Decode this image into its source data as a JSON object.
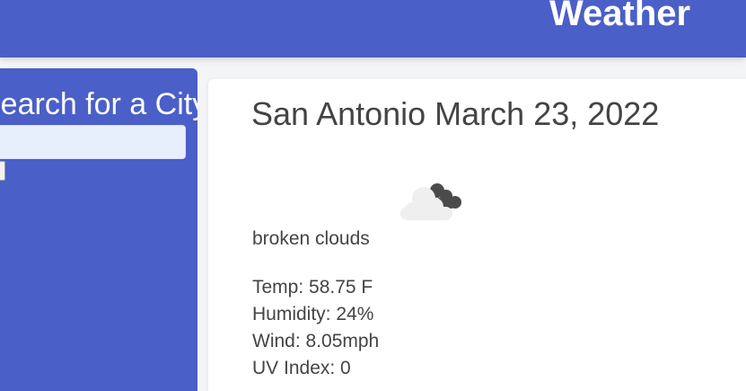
{
  "header": {
    "title": "Weather",
    "color": "#4a5fc8"
  },
  "sidebar": {
    "heading": "Search for a City:",
    "input_value": "",
    "search_button_label": "",
    "color": "#4a5fc8"
  },
  "current": {
    "city_date": "San Antonio March 23, 2022",
    "icon": "broken-clouds-icon",
    "description": "broken clouds",
    "temp": "Temp: 58.75 F",
    "humidity": "Humidity: 24%",
    "wind": "Wind: 8.05mph",
    "uv_index": "UV Index: 0"
  }
}
